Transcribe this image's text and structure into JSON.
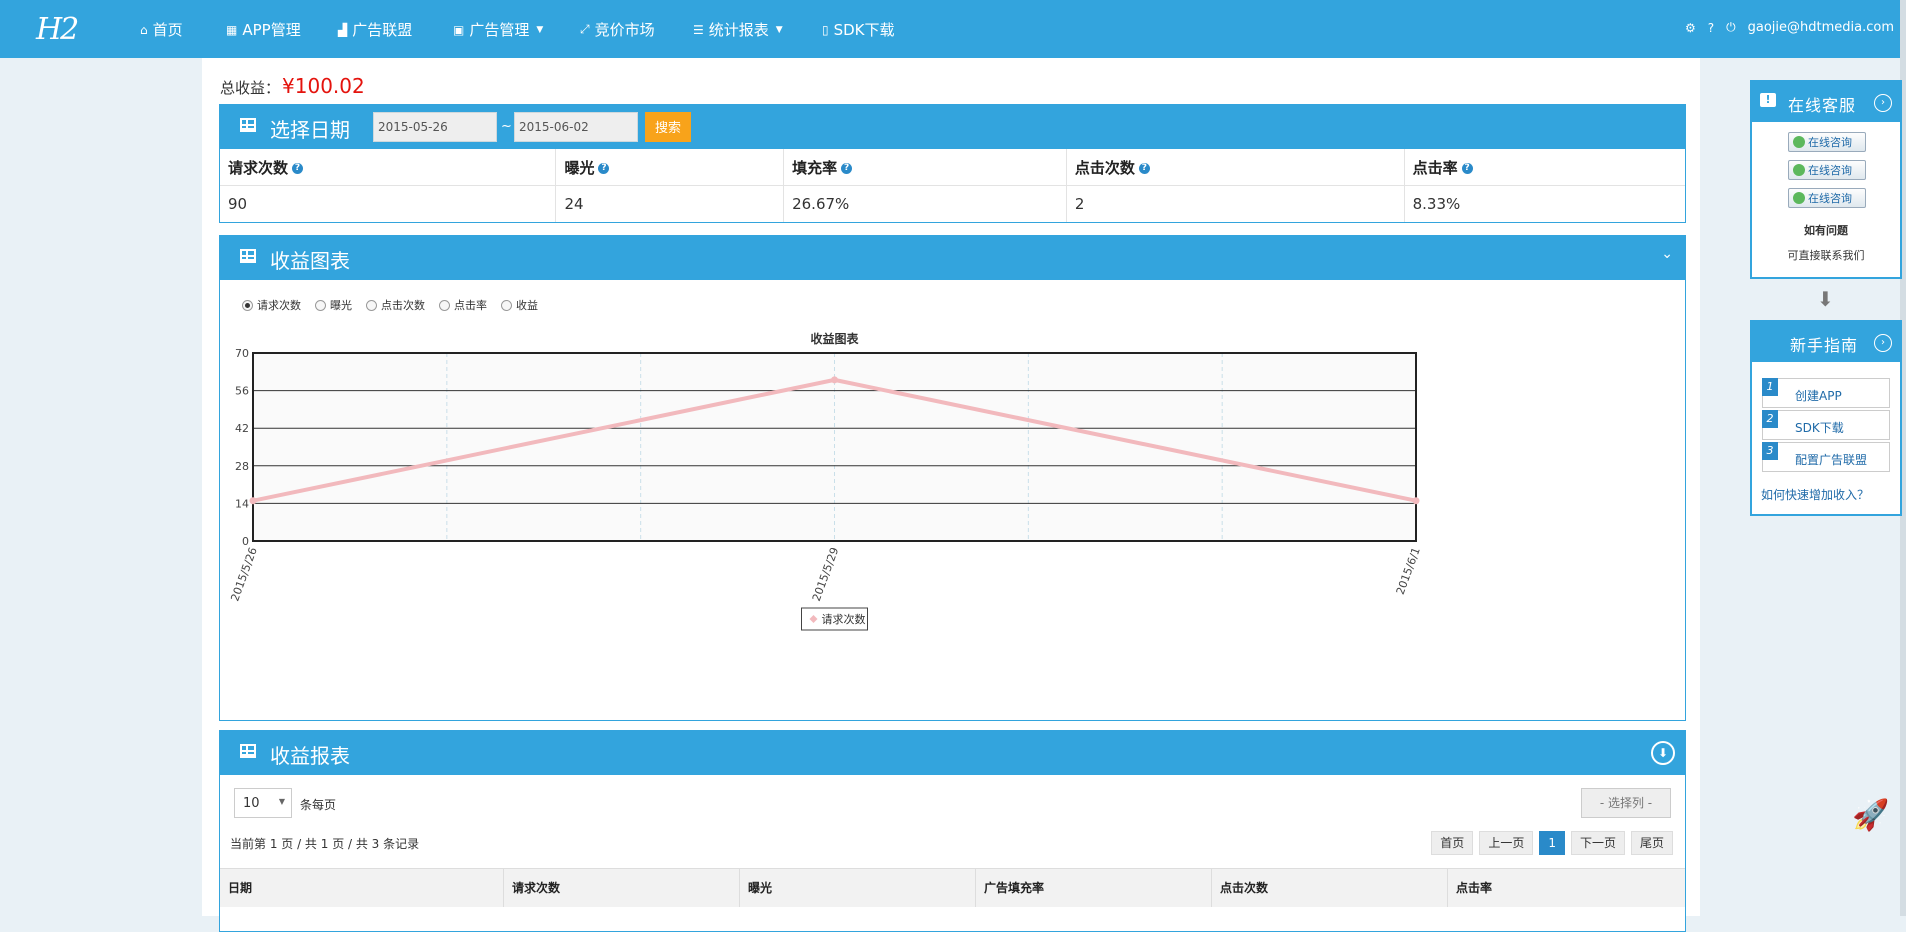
{
  "nav": {
    "logo": "H2",
    "items": [
      {
        "icon": "home-icon",
        "glyph": "⌂",
        "label": "首页"
      },
      {
        "icon": "grid-icon",
        "glyph": "▦",
        "label": "APP管理"
      },
      {
        "icon": "signal-icon",
        "glyph": "▟",
        "label": "广告联盟"
      },
      {
        "icon": "inbox-icon",
        "glyph": "▣",
        "label": "广告管理"
      },
      {
        "icon": "expand-icon",
        "glyph": "⤢",
        "label": "竞价市场"
      },
      {
        "icon": "list-icon",
        "glyph": "☰",
        "label": "统计报表"
      },
      {
        "icon": "file-icon",
        "glyph": "▯",
        "label": "SDK下载"
      }
    ],
    "user_email": "gaojie@hdtmedia.com"
  },
  "total": {
    "label": "总收益：",
    "amount": "¥100.02"
  },
  "date_panel": {
    "title": "选择日期",
    "start_date": "2015-05-26",
    "end_date": "2015-06-02",
    "separator": "~",
    "search_label": "搜索",
    "columns": [
      "请求次数",
      "曝光",
      "填充率",
      "点击次数",
      "点击率"
    ],
    "values": [
      "90",
      "24",
      "26.67%",
      "2",
      "8.33%"
    ]
  },
  "chart_panel": {
    "title": "收益图表",
    "options": [
      "请求次数",
      "曝光",
      "点击次数",
      "点击率",
      "收益"
    ],
    "selected_option": "请求次数"
  },
  "chart_data": {
    "type": "line",
    "title": "收益图表",
    "x": [
      "2015/5/26",
      "2015/5/29",
      "2015/6/1"
    ],
    "series": [
      {
        "name": "请求次数",
        "values": [
          15,
          60,
          15
        ],
        "color": "#f2b9bd"
      }
    ],
    "ylim": [
      0,
      70
    ],
    "yticks": [
      0,
      14,
      28,
      42,
      56,
      70
    ],
    "grid": true,
    "legend": "bottom-center"
  },
  "report_panel": {
    "title": "收益报表",
    "per_page_value": "10",
    "per_page_label": "条每页",
    "column_select": "- 选择列 -",
    "page_info": "当前第 1 页 / 共 1 页 / 共 3 条记录",
    "pager": [
      "首页",
      "上一页",
      "1",
      "下一页",
      "尾页"
    ],
    "current_page": "1",
    "columns": [
      "日期",
      "请求次数",
      "曝光",
      "广告填充率",
      "点击次数",
      "点击率"
    ]
  },
  "sidebar": {
    "service_title": "在线客服",
    "consult_label": "在线咨询",
    "question_title": "如有问题",
    "question_text": "可直接联系我们",
    "guide_title": "新手指南",
    "guide_items": [
      {
        "num": "1",
        "label": "创建APP"
      },
      {
        "num": "2",
        "label": "SDK下载"
      },
      {
        "num": "3",
        "label": "配置广告联盟"
      }
    ],
    "guide_link": "如何快速增加收入？"
  },
  "colors": {
    "primary": "#33a4dd",
    "accent": "#f8a31a",
    "amount": "#e4130d"
  }
}
